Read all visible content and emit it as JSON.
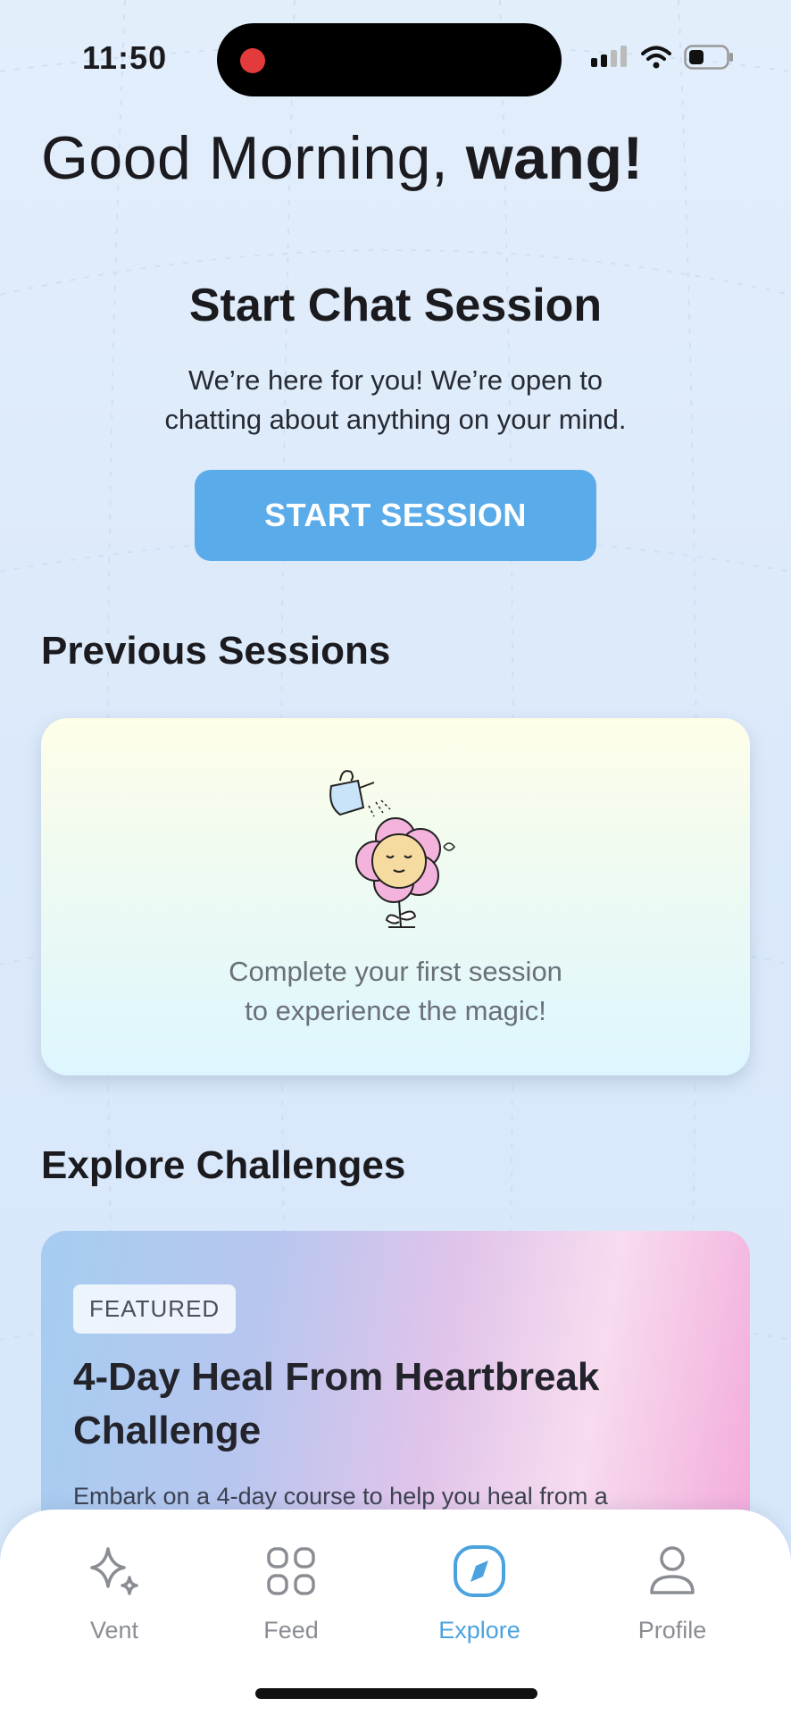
{
  "status_bar": {
    "time": "11:50"
  },
  "greeting": {
    "prefix": "Good Morning, ",
    "name": "wang!"
  },
  "chat_session": {
    "title": "Start Chat Session",
    "subtitle_line1": "We’re here for you! We’re open to",
    "subtitle_line2": "chatting about anything on your mind.",
    "button_label": "START SESSION"
  },
  "previous_sessions": {
    "heading": "Previous Sessions",
    "empty_line1": "Complete your first session",
    "empty_line2": "to experience the magic!"
  },
  "explore": {
    "heading": "Explore Challenges",
    "featured_badge": "FEATURED",
    "challenge_title": "4-Day Heal From Heartbreak Challenge",
    "challenge_desc": "Embark on a 4-day course to help you heal from a"
  },
  "tabs": [
    {
      "label": "Vent",
      "icon": "sparkle-icon",
      "active": false
    },
    {
      "label": "Feed",
      "icon": "grid-icon",
      "active": false
    },
    {
      "label": "Explore",
      "icon": "compass-icon",
      "active": true
    },
    {
      "label": "Profile",
      "icon": "person-icon",
      "active": false
    }
  ],
  "colors": {
    "accent": "#5aabe9",
    "active_tab": "#4aa3df",
    "recording_dot": "#e33b3b"
  }
}
